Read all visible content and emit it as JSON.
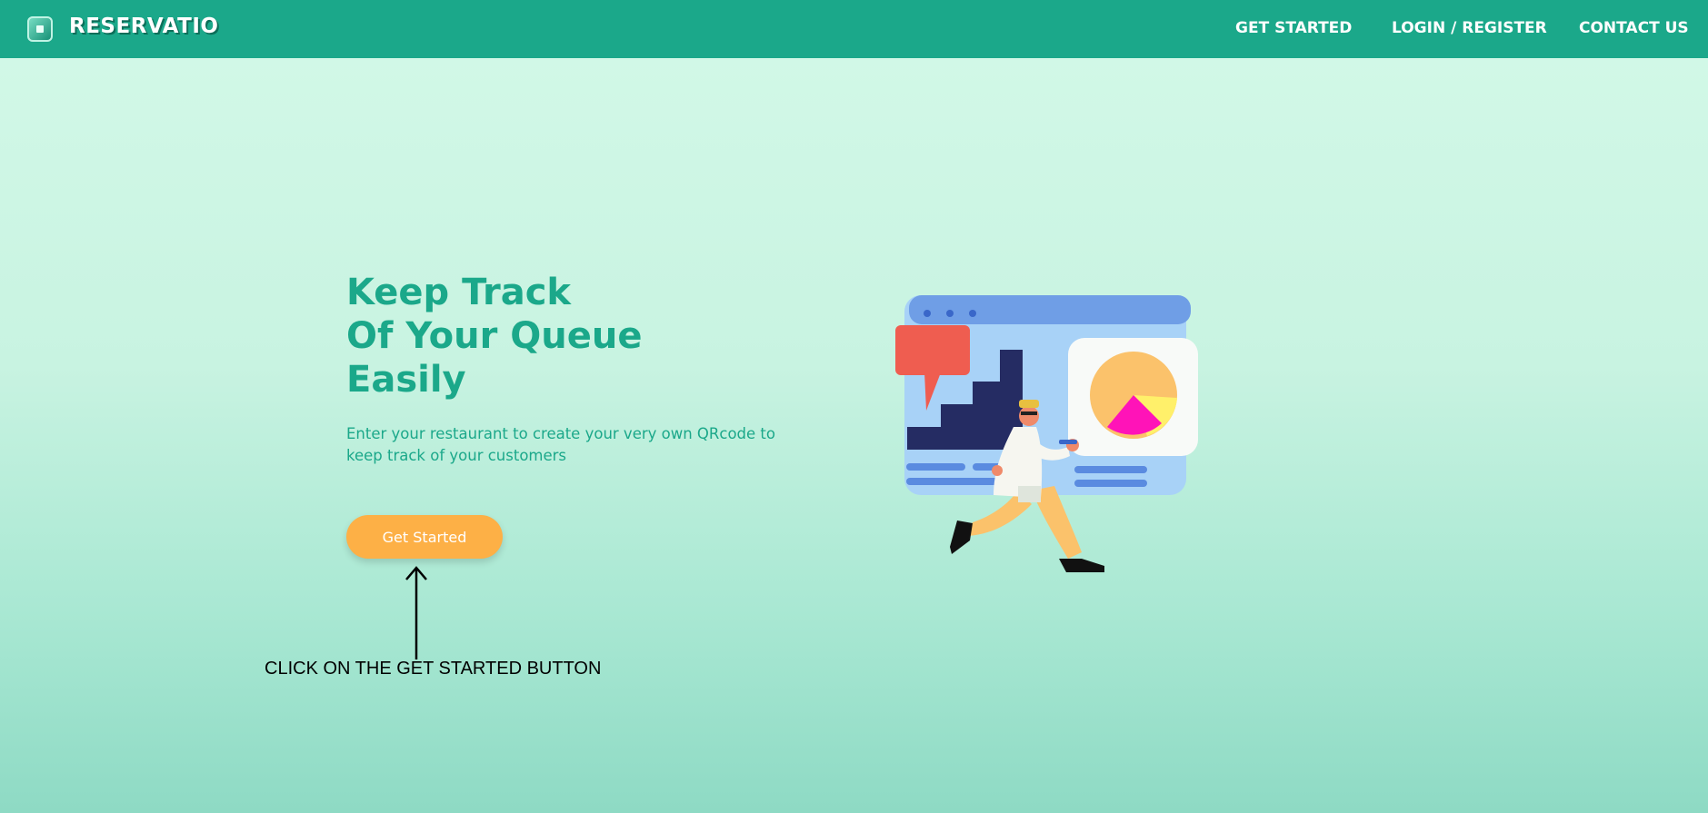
{
  "brand": {
    "name": "RESERVATIO",
    "logo_icon": "restaurant-logo-icon"
  },
  "nav": {
    "items": [
      {
        "label": "GET STARTED"
      },
      {
        "label": "LOGIN / REGISTER"
      },
      {
        "label": "CONTACT US"
      }
    ]
  },
  "hero": {
    "title_lines": [
      "Keep Track",
      "Of Your Queue",
      "Easily"
    ],
    "subtitle": "Enter your restaurant to create your very own QRcode to keep track of your customers",
    "cta_label": "Get Started",
    "illustration": "running-man-dashboard-illustration"
  },
  "annotation": {
    "text": "CLICK ON THE GET STARTED BUTTON",
    "icon": "up-arrow-icon"
  },
  "colors": {
    "navbar": "#1ba88a",
    "accent_text": "#1ba88a",
    "cta": "#fdb046",
    "background_top": "#d3f9e8",
    "background_bottom": "#8edac4"
  }
}
